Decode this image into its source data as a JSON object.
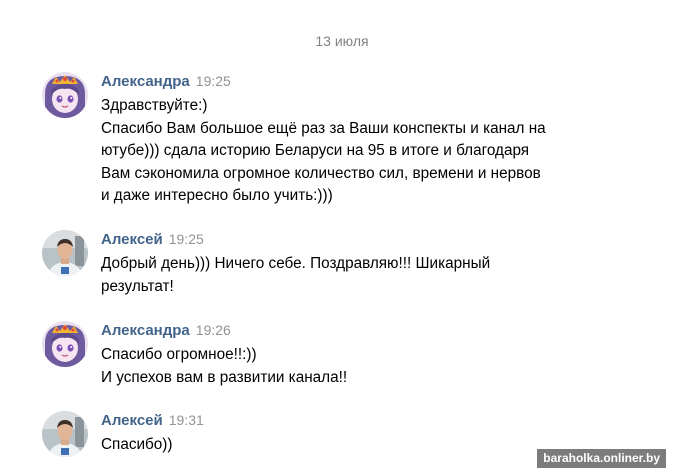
{
  "date_separator": "13 июля",
  "messages": [
    {
      "author": "Александра",
      "time": "19:25",
      "avatar_icon": "anime-girl-avatar-icon",
      "lines": [
        "Здравствуйте:)",
        "Спасибо Вам большое ещё раз за Ваши конспекты и канал на",
        "ютубе))) сдала историю Беларуси на 95 в итоге и благодаря",
        "Вам сэкономила огромное количество сил, времени и нервов",
        "и даже интересно было учить:)))"
      ]
    },
    {
      "author": "Алексей",
      "time": "19:25",
      "avatar_icon": "man-photo-avatar-icon",
      "lines": [
        "Добрый день))) Ничего себе. Поздравляю!!! Шикарный",
        "результат!"
      ]
    },
    {
      "author": "Александра",
      "time": "19:26",
      "avatar_icon": "anime-girl-avatar-icon",
      "lines": [
        "Спасибо огромное!!:))",
        "И успехов вам в развитии канала!!"
      ]
    },
    {
      "author": "Алексей",
      "time": "19:31",
      "avatar_icon": "man-photo-avatar-icon",
      "lines": [
        "Спасибо))"
      ]
    }
  ],
  "watermark": "baraholka.onliner.by",
  "colors": {
    "author_name": "#42648b",
    "timestamp": "#939393",
    "date_separator": "#828282",
    "message_text": "#000000"
  }
}
